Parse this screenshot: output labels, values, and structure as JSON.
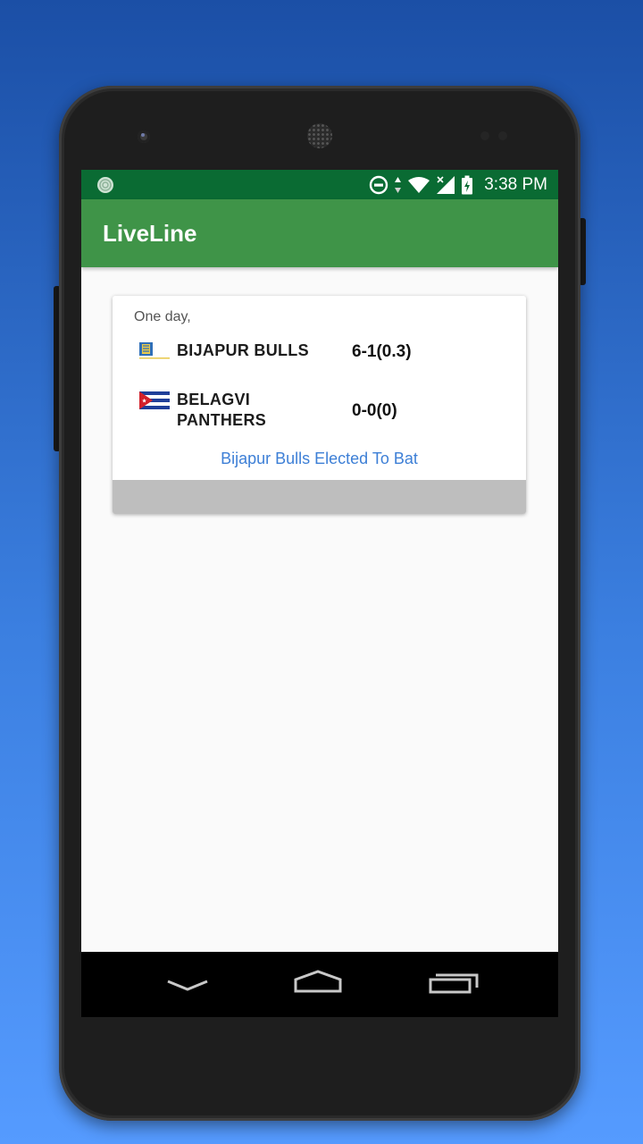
{
  "status_bar": {
    "time": "3:38 PM",
    "icons": [
      "notification-icon",
      "do-not-disturb-icon",
      "data-arrows-icon",
      "wifi-icon",
      "signal-icon",
      "battery-charging-icon"
    ]
  },
  "app_bar": {
    "title": "LiveLine"
  },
  "match_card": {
    "match_type": "One day,",
    "teams": [
      {
        "name": "BIJAPUR BULLS",
        "score": "6-1(0.3)"
      },
      {
        "name": "BELAGVI PANTHERS",
        "score": "0-0(0)"
      }
    ],
    "status": "Bijapur Bulls Elected To Bat"
  },
  "nav_bar": {
    "buttons": [
      "back-icon",
      "home-icon",
      "recents-icon"
    ]
  },
  "colors": {
    "status_bar": "#0a6b33",
    "app_bar": "#3f9448",
    "link": "#3d7fd6",
    "card_footer": "#bebebe"
  }
}
